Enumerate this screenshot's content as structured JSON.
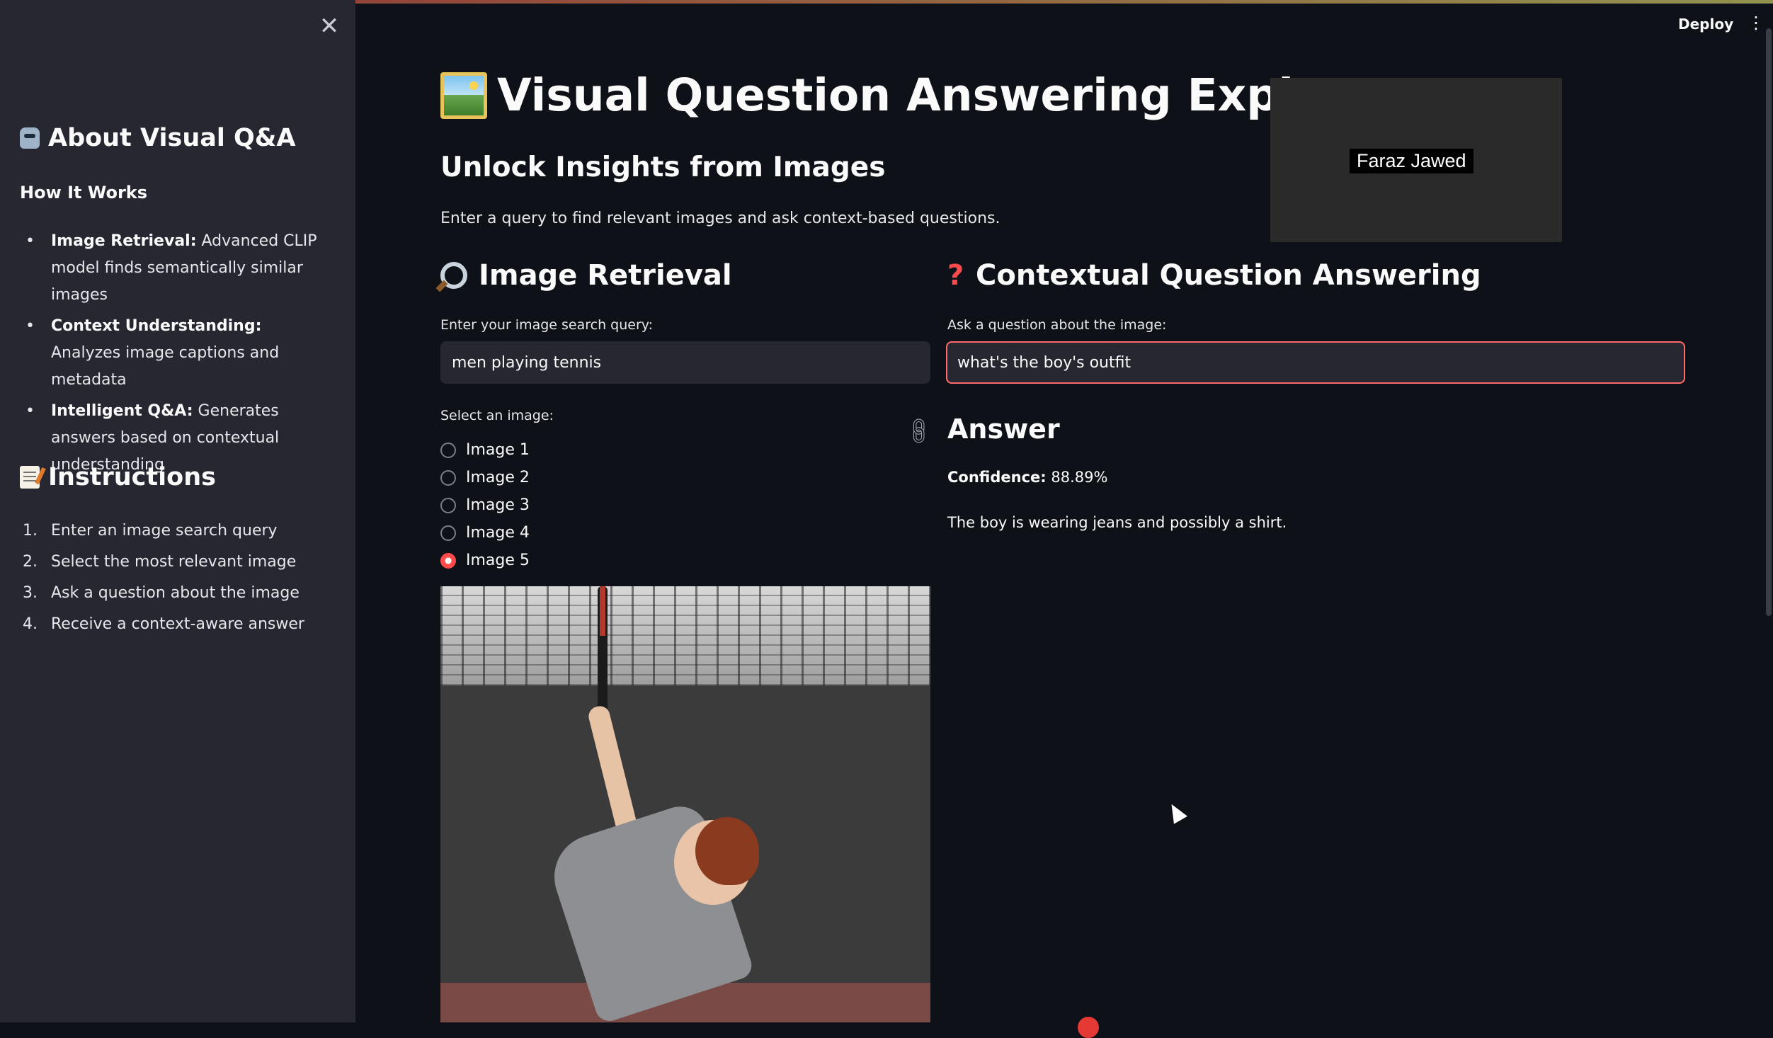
{
  "header": {
    "deploy_label": "Deploy",
    "menu_icon": "kebab-menu-icon"
  },
  "sidebar": {
    "close_icon": "close-icon",
    "about_title": "About Visual Q&A",
    "how_it_works_title": "How It Works",
    "features": [
      {
        "bold": "Image Retrieval:",
        "text": " Advanced CLIP model finds semantically similar images"
      },
      {
        "bold": "Context Understanding:",
        "text": " Analyzes image captions and metadata"
      },
      {
        "bold": "Intelligent Q&A:",
        "text": " Generates answers based on contextual understanding"
      }
    ],
    "instructions_title": "Instructions",
    "steps": [
      {
        "num": "1.",
        "text": "Enter an image search query"
      },
      {
        "num": "2.",
        "text": "Select the most relevant image"
      },
      {
        "num": "3.",
        "text": "Ask a question about the image"
      },
      {
        "num": "4.",
        "text": "Receive a context-aware answer"
      }
    ]
  },
  "main": {
    "title": "Visual Question Answering Explorer",
    "subtitle": "Unlock Insights from Images",
    "description": "Enter a query to find relevant images and ask context-based questions.",
    "retrieval": {
      "heading": "Image Retrieval",
      "search_label": "Enter your image search query:",
      "search_value": "men playing tennis",
      "select_label": "Select an image:",
      "options": [
        "Image 1",
        "Image 2",
        "Image 3",
        "Image 4",
        "Image 5"
      ],
      "selected": "Image 5"
    },
    "qa": {
      "heading": "Contextual Question Answering",
      "question_label": "Ask a question about the image:",
      "question_value": "what's the boy's outfit",
      "answer_heading": "Answer",
      "confidence_label": "Confidence:",
      "confidence_value": "88.89%",
      "answer_text": "The boy is wearing jeans and possibly a shirt."
    }
  },
  "overlay": {
    "presenter_name": "Faraz Jawed"
  },
  "colors": {
    "accent": "#ff4b4b",
    "background": "#0e1117",
    "sidebar": "#262730"
  }
}
